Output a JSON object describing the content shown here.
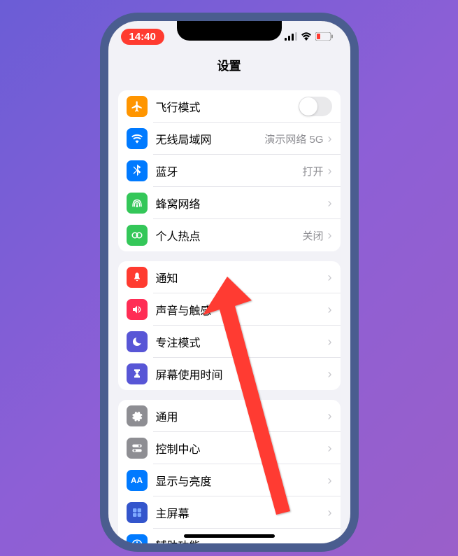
{
  "statusBar": {
    "time": "14:40"
  },
  "header": {
    "title": "设置"
  },
  "groups": [
    {
      "rows": [
        {
          "icon": "airplane",
          "iconBg": "#ff9500",
          "label": "飞行模式",
          "control": "toggle"
        },
        {
          "icon": "wifi",
          "iconBg": "#007aff",
          "label": "无线局域网",
          "value": "演示网络 5G"
        },
        {
          "icon": "bluetooth",
          "iconBg": "#007aff",
          "label": "蓝牙",
          "value": "打开"
        },
        {
          "icon": "cellular",
          "iconBg": "#34c759",
          "label": "蜂窝网络"
        },
        {
          "icon": "hotspot",
          "iconBg": "#34c759",
          "label": "个人热点",
          "value": "关闭"
        }
      ]
    },
    {
      "rows": [
        {
          "icon": "notifications",
          "iconBg": "#ff3b30",
          "label": "通知"
        },
        {
          "icon": "sounds",
          "iconBg": "#ff2d55",
          "label": "声音与触感"
        },
        {
          "icon": "focus",
          "iconBg": "#5856d6",
          "label": "专注模式"
        },
        {
          "icon": "screentime",
          "iconBg": "#5856d6",
          "label": "屏幕使用时间"
        }
      ]
    },
    {
      "rows": [
        {
          "icon": "general",
          "iconBg": "#8e8e93",
          "label": "通用"
        },
        {
          "icon": "controlcenter",
          "iconBg": "#8e8e93",
          "label": "控制中心"
        },
        {
          "icon": "display",
          "iconBg": "#007aff",
          "label": "显示与亮度"
        },
        {
          "icon": "homescreen",
          "iconBg": "#3355cc",
          "label": "主屏幕"
        },
        {
          "icon": "accessibility",
          "iconBg": "#007aff",
          "label": "辅助功能"
        }
      ]
    }
  ]
}
